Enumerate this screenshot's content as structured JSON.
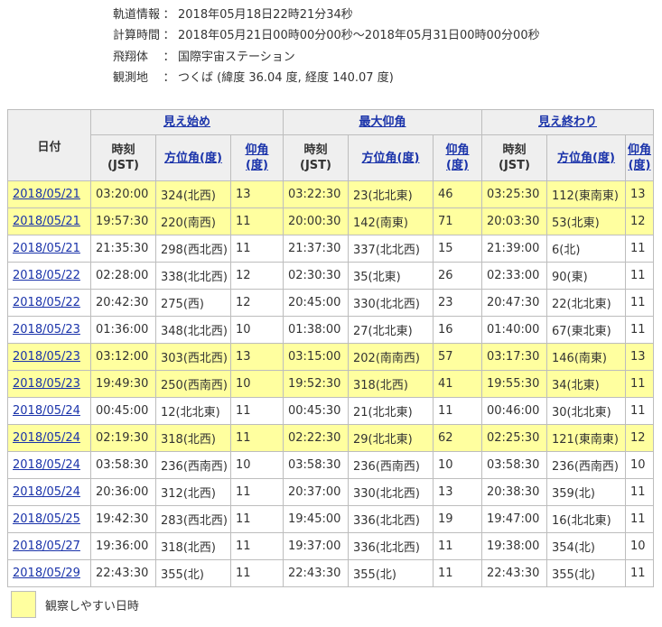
{
  "info": [
    {
      "label": "軌道情報",
      "colon": "：",
      "value": "2018年05月18日22時21分34秒"
    },
    {
      "label": "計算時間",
      "colon": "：",
      "value": "2018年05月21日00時00分00秒〜2018年05月31日00時00分00秒"
    },
    {
      "label": "飛翔体",
      "colon": "：",
      "value": "国際宇宙ステーション"
    },
    {
      "label": "観測地",
      "colon": "：",
      "value": "つくば (緯度 36.04 度, 経度 140.07 度)"
    }
  ],
  "table": {
    "date_header": "日付",
    "groups": [
      {
        "label": "見え始め"
      },
      {
        "label": "最大仰角"
      },
      {
        "label": "見え終わり"
      }
    ],
    "sub": {
      "time_line1": "時刻",
      "time_line2": "(JST)",
      "azimuth": "方位角(度)",
      "elev_line1": "仰角",
      "elev_line2": "(度)"
    },
    "rows": [
      {
        "highlight": true,
        "date": "2018/05/21",
        "cells": [
          "03:20:00",
          "324(北西)",
          "13",
          "03:22:30",
          "23(北北東)",
          "46",
          "03:25:30",
          "112(東南東)",
          "13"
        ]
      },
      {
        "highlight": true,
        "date": "2018/05/21",
        "cells": [
          "19:57:30",
          "220(南西)",
          "11",
          "20:00:30",
          "142(南東)",
          "71",
          "20:03:30",
          "53(北東)",
          "12"
        ]
      },
      {
        "highlight": false,
        "date": "2018/05/21",
        "cells": [
          "21:35:30",
          "298(西北西)",
          "11",
          "21:37:30",
          "337(北北西)",
          "15",
          "21:39:00",
          "6(北)",
          "11"
        ]
      },
      {
        "highlight": false,
        "date": "2018/05/22",
        "cells": [
          "02:28:00",
          "338(北北西)",
          "12",
          "02:30:30",
          "35(北東)",
          "26",
          "02:33:00",
          "90(東)",
          "11"
        ]
      },
      {
        "highlight": false,
        "date": "2018/05/22",
        "cells": [
          "20:42:30",
          "275(西)",
          "12",
          "20:45:00",
          "330(北北西)",
          "23",
          "20:47:30",
          "22(北北東)",
          "11"
        ]
      },
      {
        "highlight": false,
        "date": "2018/05/23",
        "cells": [
          "01:36:00",
          "348(北北西)",
          "10",
          "01:38:00",
          "27(北北東)",
          "16",
          "01:40:00",
          "67(東北東)",
          "11"
        ]
      },
      {
        "highlight": true,
        "date": "2018/05/23",
        "cells": [
          "03:12:00",
          "303(西北西)",
          "13",
          "03:15:00",
          "202(南南西)",
          "57",
          "03:17:30",
          "146(南東)",
          "13"
        ]
      },
      {
        "highlight": true,
        "date": "2018/05/23",
        "cells": [
          "19:49:30",
          "250(西南西)",
          "10",
          "19:52:30",
          "318(北西)",
          "41",
          "19:55:30",
          "34(北東)",
          "11"
        ]
      },
      {
        "highlight": false,
        "date": "2018/05/24",
        "cells": [
          "00:45:00",
          "12(北北東)",
          "11",
          "00:45:30",
          "21(北北東)",
          "11",
          "00:46:00",
          "30(北北東)",
          "11"
        ]
      },
      {
        "highlight": true,
        "date": "2018/05/24",
        "cells": [
          "02:19:30",
          "318(北西)",
          "11",
          "02:22:30",
          "29(北北東)",
          "62",
          "02:25:30",
          "121(東南東)",
          "12"
        ]
      },
      {
        "highlight": false,
        "date": "2018/05/24",
        "cells": [
          "03:58:30",
          "236(西南西)",
          "10",
          "03:58:30",
          "236(西南西)",
          "10",
          "03:58:30",
          "236(西南西)",
          "10"
        ]
      },
      {
        "highlight": false,
        "date": "2018/05/24",
        "cells": [
          "20:36:00",
          "312(北西)",
          "11",
          "20:37:00",
          "330(北北西)",
          "13",
          "20:38:30",
          "359(北)",
          "11"
        ]
      },
      {
        "highlight": false,
        "date": "2018/05/25",
        "cells": [
          "19:42:30",
          "283(西北西)",
          "11",
          "19:45:00",
          "336(北北西)",
          "19",
          "19:47:00",
          "16(北北東)",
          "11"
        ]
      },
      {
        "highlight": false,
        "date": "2018/05/27",
        "cells": [
          "19:36:00",
          "318(北西)",
          "11",
          "19:37:00",
          "336(北北西)",
          "11",
          "19:38:00",
          "354(北)",
          "10"
        ]
      },
      {
        "highlight": false,
        "date": "2018/05/29",
        "cells": [
          "22:43:30",
          "355(北)",
          "11",
          "22:43:30",
          "355(北)",
          "11",
          "22:43:30",
          "355(北)",
          "11"
        ]
      }
    ]
  },
  "legend": {
    "label": "観察しやすい日時"
  },
  "colors": {
    "highlight": "#ffff9f",
    "link": "#1a33aa",
    "header_bg": "#efefef",
    "border": "#bdbdbd"
  }
}
